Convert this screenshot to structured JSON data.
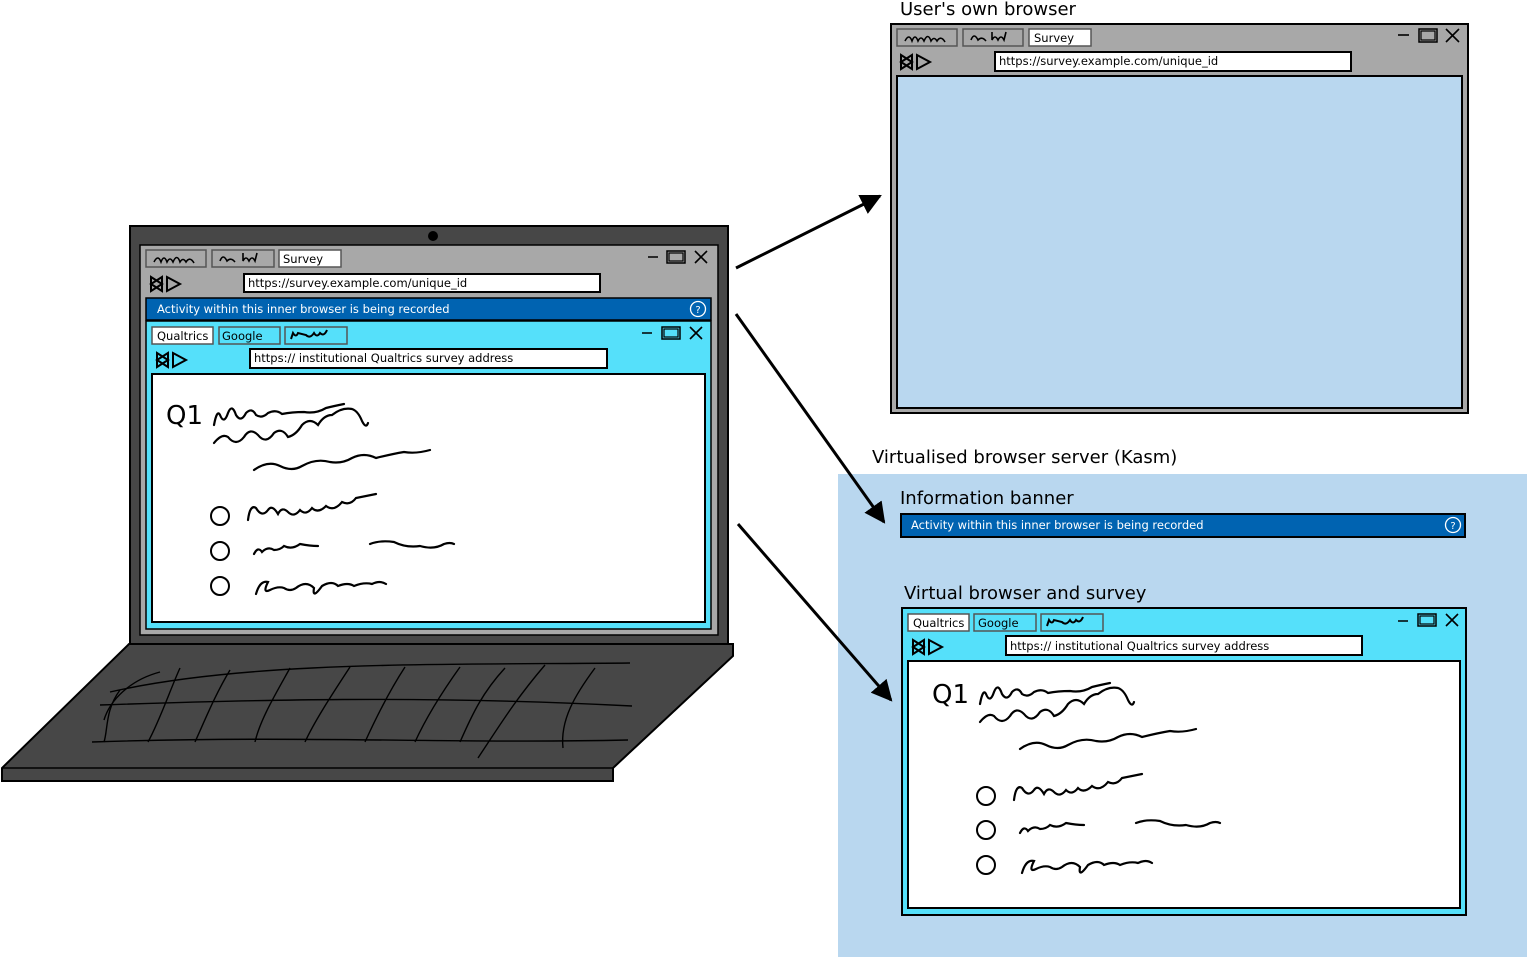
{
  "labels": {
    "users_browser_title": "User's own browser",
    "server_title": "Virtualised browser server (Kasm)",
    "banner_title": "Information banner",
    "virtual_browser_title": "Virtual browser and survey"
  },
  "outer_browser": {
    "tab_active": "Survey",
    "url": "https://survey.example.com/unique_id"
  },
  "banner": {
    "text": "Activity within this inner browser is being recorded",
    "help_glyph": "?"
  },
  "inner_browser": {
    "tabs": [
      "Qualtrics",
      "Google"
    ],
    "url": "https:// institutional Qualtrics survey address",
    "question_label": "Q1"
  },
  "colors": {
    "banner_blue": "#0063b1",
    "inner_cyan": "#55e0fa",
    "server_bg": "#b9d7ef",
    "outer_chrome_gray": "#a8a8a8",
    "laptop_dark": "#474747"
  },
  "icons": [
    "back-forward-icon",
    "minimize-icon",
    "maximize-icon",
    "close-icon",
    "help-icon",
    "radio-button-icon"
  ]
}
